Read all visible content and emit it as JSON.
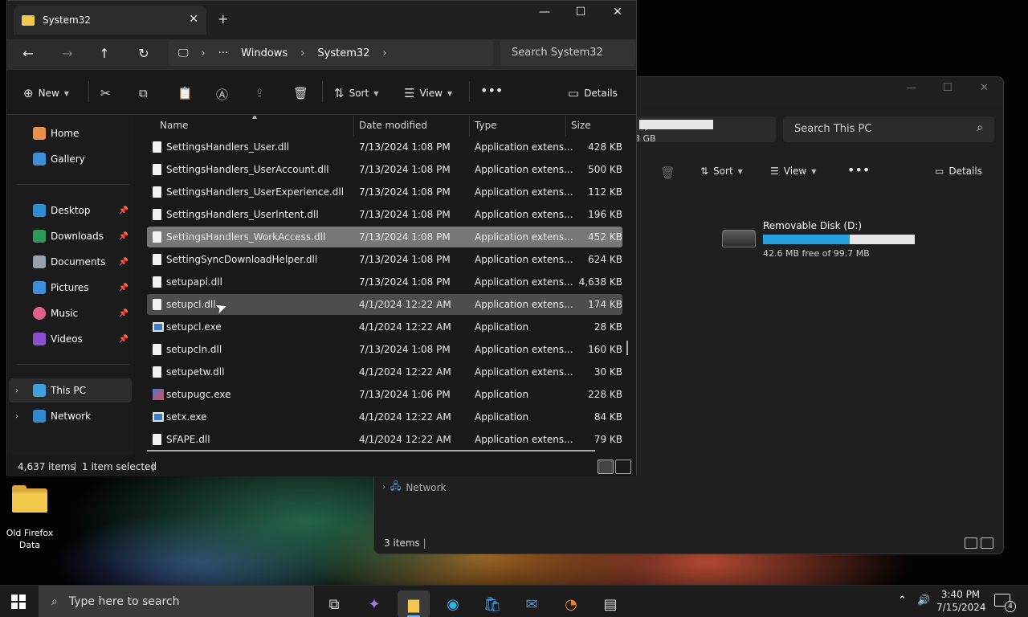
{
  "desktop": {
    "icon_label": "Old Firefox Data"
  },
  "window_bg": {
    "search_placeholder": "Search This PC",
    "toolbar": {
      "sort": "Sort",
      "view": "View",
      "details": "Details"
    },
    "drive": {
      "name": "Removable Disk (D:)",
      "free": "42.6 MB free of 99.7 MB",
      "used_fraction": 0.57
    },
    "other_drive_free_tail": "3 GB",
    "nav_network": "Network",
    "status_items": "3 items"
  },
  "window": {
    "tab_title": "System32",
    "breadcrumb": [
      "Windows",
      "System32"
    ],
    "search_placeholder": "Search System32",
    "toolbar": {
      "new": "New",
      "sort": "Sort",
      "view": "View",
      "details": "Details"
    },
    "sidebar": {
      "home": "Home",
      "gallery": "Gallery",
      "desktop": "Desktop",
      "downloads": "Downloads",
      "documents": "Documents",
      "pictures": "Pictures",
      "music": "Music",
      "videos": "Videos",
      "this_pc": "This PC",
      "network": "Network"
    },
    "columns": {
      "name": "Name",
      "date": "Date modified",
      "type": "Type",
      "size": "Size"
    },
    "files": [
      {
        "name": "SettingsHandlers_User.dll",
        "date": "7/13/2024 1:08 PM",
        "type": "Application extens...",
        "size": "428 KB"
      },
      {
        "name": "SettingsHandlers_UserAccount.dll",
        "date": "7/13/2024 1:08 PM",
        "type": "Application extens...",
        "size": "500 KB"
      },
      {
        "name": "SettingsHandlers_UserExperience.dll",
        "date": "7/13/2024 1:08 PM",
        "type": "Application extens...",
        "size": "112 KB"
      },
      {
        "name": "SettingsHandlers_UserIntent.dll",
        "date": "7/13/2024 1:08 PM",
        "type": "Application extens...",
        "size": "196 KB"
      },
      {
        "name": "SettingsHandlers_WorkAccess.dll",
        "date": "7/13/2024 1:08 PM",
        "type": "Application extens...",
        "size": "452 KB"
      },
      {
        "name": "SettingSyncDownloadHelper.dll",
        "date": "7/13/2024 1:08 PM",
        "type": "Application extens...",
        "size": "624 KB"
      },
      {
        "name": "setupapi.dll",
        "date": "7/13/2024 1:08 PM",
        "type": "Application extens...",
        "size": "4,638 KB"
      },
      {
        "name": "setupcl.dll",
        "date": "4/1/2024 12:22 AM",
        "type": "Application extens...",
        "size": "174 KB"
      },
      {
        "name": "setupcl.exe",
        "date": "4/1/2024 12:22 AM",
        "type": "Application",
        "size": "28 KB"
      },
      {
        "name": "setupcln.dll",
        "date": "7/13/2024 1:08 PM",
        "type": "Application extens...",
        "size": "160 KB"
      },
      {
        "name": "setupetw.dll",
        "date": "4/1/2024 12:22 AM",
        "type": "Application extens...",
        "size": "30 KB"
      },
      {
        "name": "setupugc.exe",
        "date": "7/13/2024 1:06 PM",
        "type": "Application",
        "size": "228 KB"
      },
      {
        "name": "setx.exe",
        "date": "4/1/2024 12:22 AM",
        "type": "Application",
        "size": "84 KB"
      },
      {
        "name": "SFAPE.dll",
        "date": "4/1/2024 12:22 AM",
        "type": "Application extens...",
        "size": "79 KB"
      }
    ],
    "status": {
      "count": "4,637 items",
      "selected": "1 item selected"
    }
  },
  "taskbar": {
    "search_placeholder": "Type here to search",
    "time": "3:40 PM",
    "date": "7/15/2024",
    "notifications": "4"
  }
}
